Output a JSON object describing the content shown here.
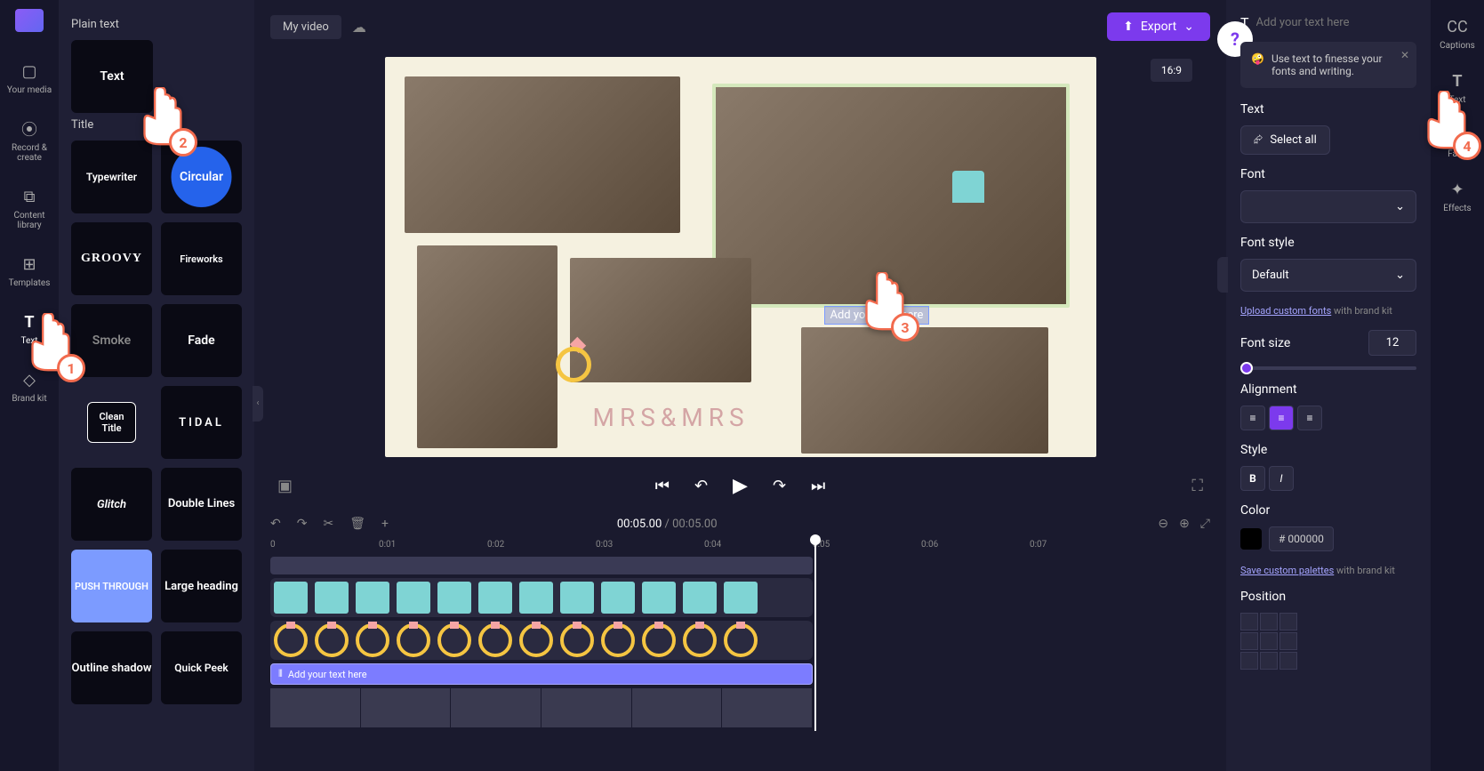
{
  "left_rail": {
    "items": [
      {
        "label": "Your media"
      },
      {
        "label": "Record & create"
      },
      {
        "label": "Content library"
      },
      {
        "label": "Templates"
      },
      {
        "label": "Text"
      },
      {
        "label": "Brand kit"
      }
    ]
  },
  "text_panel": {
    "plain_heading": "Plain text",
    "plain_card": "Text",
    "title_heading": "Title",
    "titles": [
      "Typewriter",
      "Circular",
      "GROOVY",
      "Fireworks",
      "Smoke",
      "Fade",
      "Clean Title",
      "TIDAL",
      "Glitch",
      "Double Lines",
      "PUSH THROUGH",
      "Large heading",
      "Outline shadow",
      "Quick Peek"
    ]
  },
  "top_bar": {
    "video_name": "My video",
    "export": "Export"
  },
  "canvas": {
    "aspect": "16:9",
    "text_placeholder": "Add your text here",
    "mrs": "MRS&MRS"
  },
  "timeline": {
    "current": "00:05.00",
    "duration": "00:05.00",
    "ticks": [
      "0",
      "0:01",
      "0:02",
      "0:03",
      "0:04",
      "0:05",
      "0:06",
      "0:07"
    ],
    "text_track": "Add your text here"
  },
  "right_panel": {
    "top_placeholder": "Add your text here",
    "tip": "Use text to finesse your fonts and writing.",
    "text_heading": "Text",
    "select_all": "Select all",
    "font_heading": "Font",
    "font_style_heading": "Font style",
    "font_style_value": "Default",
    "upload_fonts": "Upload custom fonts",
    "upload_fonts_after": " with brand kit",
    "font_size_heading": "Font size",
    "font_size_value": "12",
    "alignment_heading": "Alignment",
    "style_heading": "Style",
    "color_heading": "Color",
    "color_value": "000000",
    "palettes": "Save custom palettes",
    "palettes_after": " with brand kit",
    "position_heading": "Position"
  },
  "right_rail": {
    "items": [
      {
        "label": "Captions"
      },
      {
        "label": "Text"
      },
      {
        "label": "Fade"
      },
      {
        "label": "Effects"
      }
    ]
  },
  "pointers": [
    "1",
    "2",
    "3",
    "4"
  ]
}
